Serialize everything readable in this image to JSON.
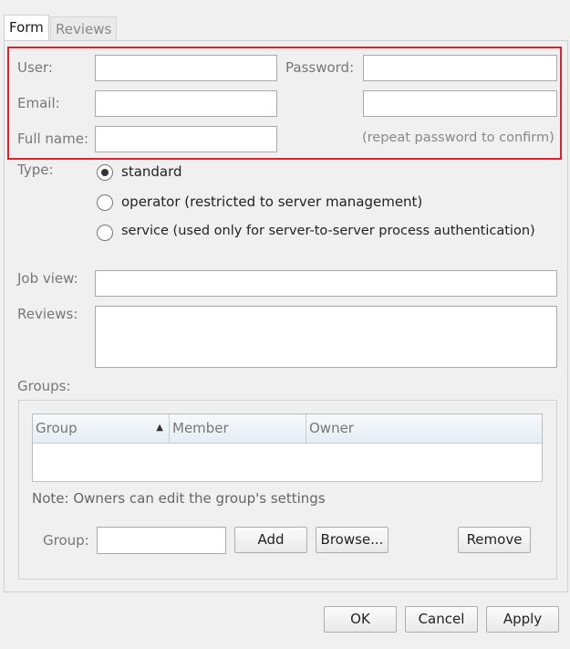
{
  "tabs": [
    {
      "label": "Form",
      "active": true
    },
    {
      "label": "Reviews",
      "active": false
    }
  ],
  "account": {
    "user_label": "User:",
    "user_value": "",
    "password_label": "Password:",
    "password_value": "",
    "email_label": "Email:",
    "email_value": "",
    "password_confirm_value": "",
    "fullname_label": "Full name:",
    "fullname_value": "",
    "confirm_hint": "(repeat password to confirm)"
  },
  "type": {
    "label": "Type:",
    "options": [
      {
        "label": "standard",
        "checked": true
      },
      {
        "label": "operator (restricted to server management)",
        "checked": false
      },
      {
        "label": "service (used only for server-to-server process authentication)",
        "checked": false
      }
    ]
  },
  "jobview": {
    "label": "Job view:",
    "value": ""
  },
  "reviews": {
    "label": "Reviews:",
    "value": ""
  },
  "groups": {
    "label": "Groups:",
    "columns": [
      "Group",
      "Member",
      "Owner"
    ],
    "sort_indicator": "▲",
    "rows": [],
    "note": "Note: Owners can edit the group's settings",
    "group_field_label": "Group:",
    "group_field_value": "",
    "add_label": "Add",
    "browse_label": "Browse...",
    "remove_label": "Remove"
  },
  "footer": {
    "ok_label": "OK",
    "cancel_label": "Cancel",
    "apply_label": "Apply"
  },
  "colors": {
    "highlight": "#e0202a",
    "tab_accent": "#3a7bd5"
  }
}
